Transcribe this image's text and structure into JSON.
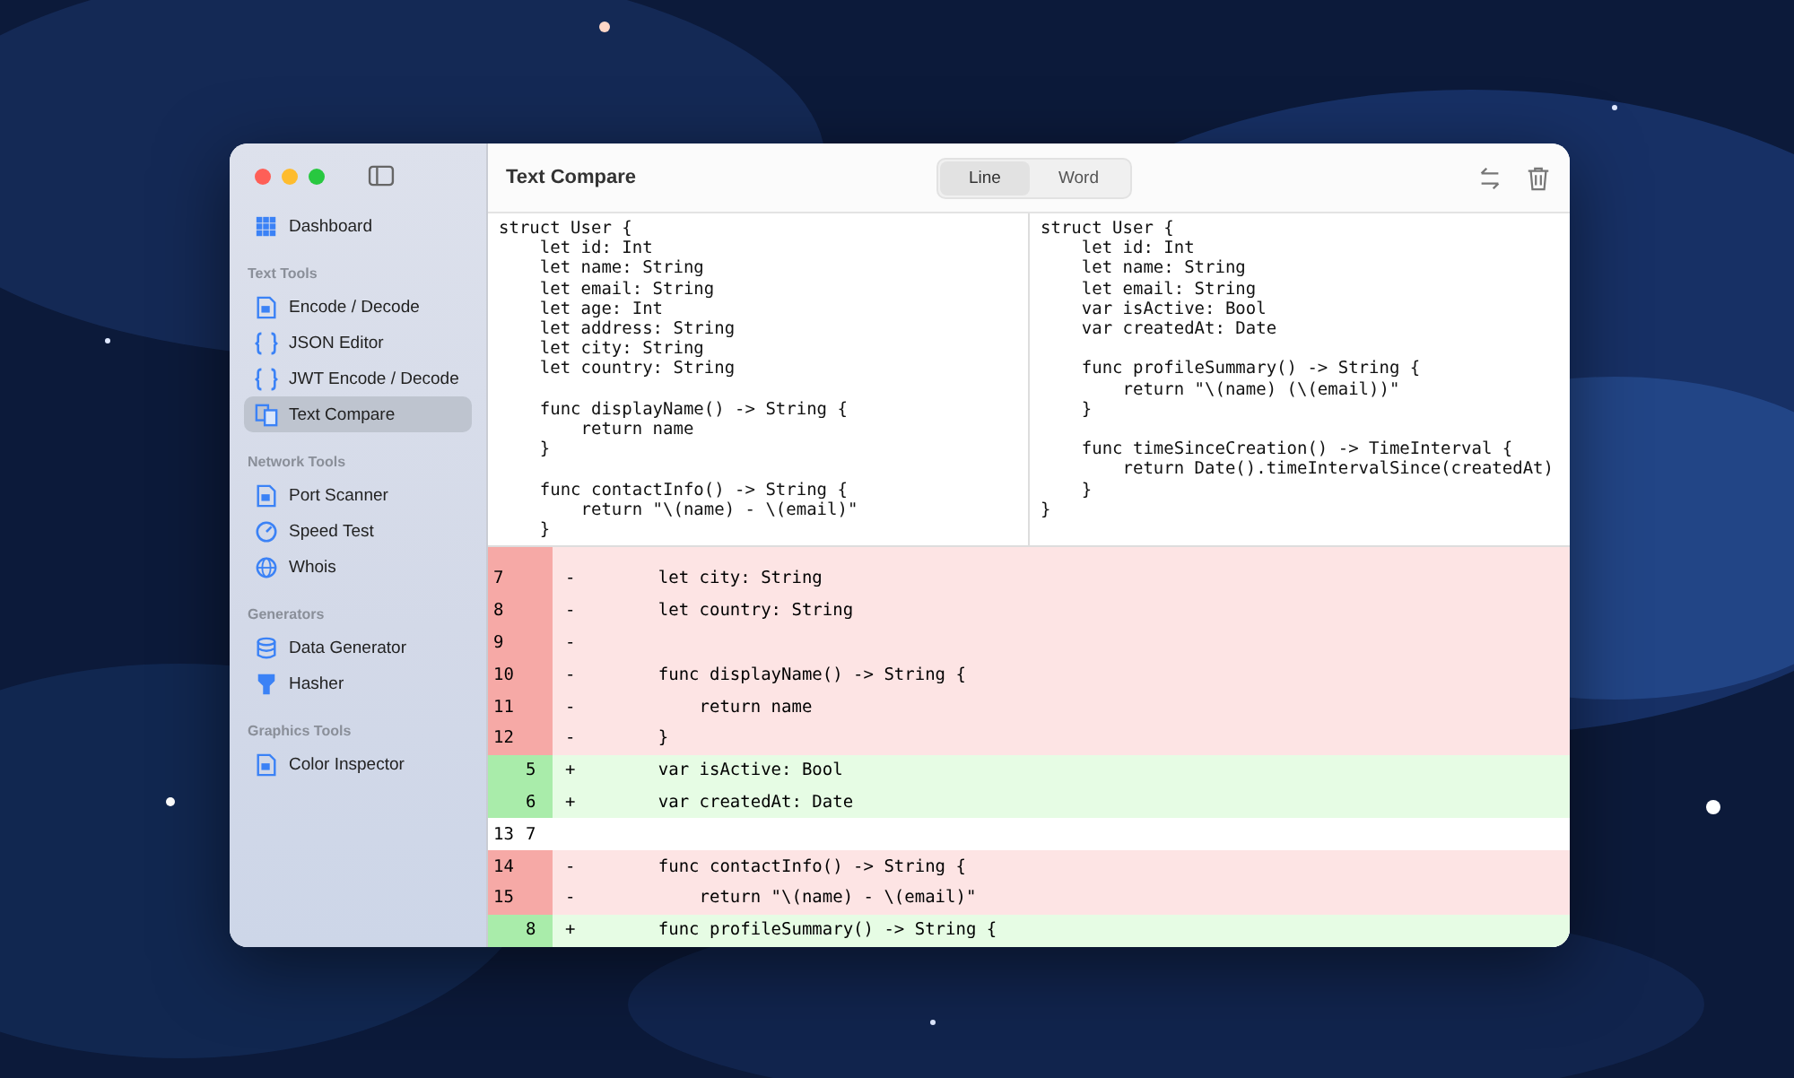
{
  "window": {
    "title": "Text Compare"
  },
  "sidebar": {
    "items": [
      {
        "kind": "item",
        "label": "Dashboard",
        "selected": false
      },
      {
        "kind": "section",
        "label": "Text Tools"
      },
      {
        "kind": "item",
        "label": "Encode / Decode",
        "selected": false
      },
      {
        "kind": "item",
        "label": "JSON Editor",
        "selected": false
      },
      {
        "kind": "item",
        "label": "JWT Encode / Decode",
        "selected": false
      },
      {
        "kind": "item",
        "label": "Text Compare",
        "selected": true
      },
      {
        "kind": "section",
        "label": "Network Tools"
      },
      {
        "kind": "item",
        "label": "Port Scanner",
        "selected": false
      },
      {
        "kind": "item",
        "label": "Speed Test",
        "selected": false
      },
      {
        "kind": "item",
        "label": "Whois",
        "selected": false
      },
      {
        "kind": "section",
        "label": "Generators"
      },
      {
        "kind": "item",
        "label": "Data Generator",
        "selected": false
      },
      {
        "kind": "item",
        "label": "Hasher",
        "selected": false
      },
      {
        "kind": "section",
        "label": "Graphics Tools"
      },
      {
        "kind": "item",
        "label": "Color Inspector",
        "selected": false
      }
    ]
  },
  "modes": [
    {
      "label": "Line",
      "selected": true
    },
    {
      "label": "Word",
      "selected": false
    }
  ],
  "left_text": "struct User {\n    let id: Int\n    let name: String\n    let email: String\n    let age: Int\n    let address: String\n    let city: String\n    let country: String\n\n    func displayName() -> String {\n        return name\n    }\n\n    func contactInfo() -> String {\n        return \"\\(name) - \\(email)\"\n    }",
  "right_text": "struct User {\n    let id: Int\n    let name: String\n    let email: String\n    var isActive: Bool\n    var createdAt: Date\n\n    func profileSummary() -> String {\n        return \"\\(name) (\\(email))\"\n    }\n\n    func timeSinceCreation() -> TimeInterval {\n        return Date().timeIntervalSince(createdAt)\n    }\n}",
  "diff_rows": [
    {
      "kind": "removed",
      "old": "7",
      "marker": "-",
      "code": "    let city: String"
    },
    {
      "kind": "removed",
      "old": "8",
      "marker": "-",
      "code": "    let country: String"
    },
    {
      "kind": "removed",
      "old": "9",
      "marker": "-",
      "code": ""
    },
    {
      "kind": "removed",
      "old": "10",
      "marker": "-",
      "code": "    func displayName() -> String {"
    },
    {
      "kind": "removed",
      "old": "11",
      "marker": "-",
      "code": "        return name"
    },
    {
      "kind": "removed",
      "old": "12",
      "marker": "-",
      "code": "    }"
    },
    {
      "kind": "added",
      "new": "5",
      "marker": "+",
      "code": "    var isActive: Bool"
    },
    {
      "kind": "added",
      "new": "6",
      "marker": "+",
      "code": "    var createdAt: Date"
    },
    {
      "kind": "same",
      "old": "13",
      "new": "7",
      "code": ""
    },
    {
      "kind": "removed",
      "old": "14",
      "marker": "-",
      "code": "    func contactInfo() -> String {"
    },
    {
      "kind": "removed",
      "old": "15",
      "marker": "-",
      "code": "        return \"\\(name) - \\(email)\""
    },
    {
      "kind": "added",
      "new": "8",
      "marker": "+",
      "code": "    func profileSummary() -> String {"
    }
  ]
}
